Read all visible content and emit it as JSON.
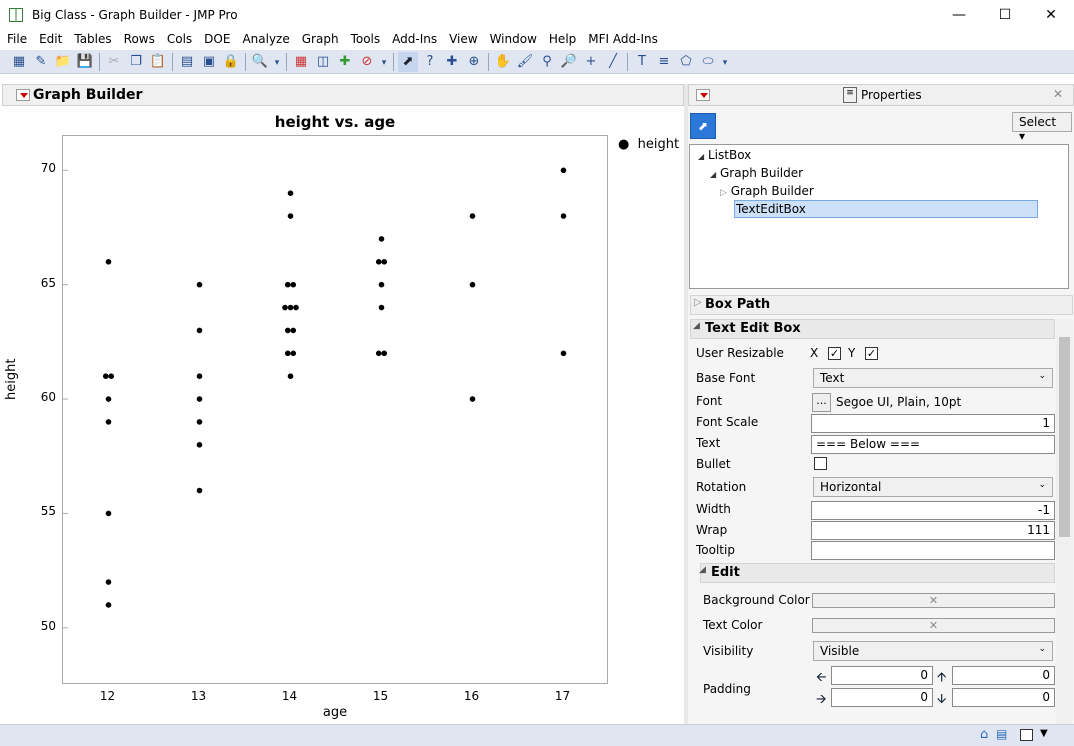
{
  "window": {
    "title": "Big Class - Graph Builder - JMP Pro"
  },
  "menu": [
    "File",
    "Edit",
    "Tables",
    "Rows",
    "Cols",
    "DOE",
    "Analyze",
    "Graph",
    "Tools",
    "Add-Ins",
    "View",
    "Window",
    "Help",
    "MFI Add-Ins"
  ],
  "graph_builder": {
    "header": "Graph Builder",
    "legend_label": "height"
  },
  "chart_data": {
    "type": "scatter",
    "title": "height vs. age",
    "xlabel": "age",
    "ylabel": "height",
    "x_ticks": [
      "12",
      "13",
      "14",
      "15",
      "16",
      "17"
    ],
    "y_ticks": [
      "50",
      "55",
      "60",
      "65",
      "70"
    ],
    "ylim": [
      47.5,
      71.5
    ],
    "xlim": [
      11.5,
      17.5
    ],
    "grid": false,
    "legend": "top-right",
    "points": [
      [
        12,
        66
      ],
      [
        12,
        61
      ],
      [
        12,
        61
      ],
      [
        12,
        60
      ],
      [
        12,
        59
      ],
      [
        12,
        55
      ],
      [
        12,
        52
      ],
      [
        12,
        51
      ],
      [
        13,
        65
      ],
      [
        13,
        63
      ],
      [
        13,
        61
      ],
      [
        13,
        60
      ],
      [
        13,
        59
      ],
      [
        13,
        58
      ],
      [
        13,
        56
      ],
      [
        14,
        69
      ],
      [
        14,
        68
      ],
      [
        14,
        65
      ],
      [
        14,
        65
      ],
      [
        14,
        64
      ],
      [
        14,
        64
      ],
      [
        14,
        64
      ],
      [
        14,
        63
      ],
      [
        14,
        63
      ],
      [
        14,
        62
      ],
      [
        14,
        62
      ],
      [
        14,
        61
      ],
      [
        15,
        67
      ],
      [
        15,
        66
      ],
      [
        15,
        66
      ],
      [
        15,
        65
      ],
      [
        15,
        64
      ],
      [
        15,
        62
      ],
      [
        15,
        62
      ],
      [
        16,
        68
      ],
      [
        16,
        65
      ],
      [
        16,
        60
      ],
      [
        17,
        70
      ],
      [
        17,
        68
      ],
      [
        17,
        62
      ]
    ]
  },
  "properties": {
    "title": "Properties",
    "select_label": "Select",
    "tree": [
      "ListBox",
      "Graph Builder",
      "Graph Builder",
      "TextEditBox"
    ],
    "box_path": "Box Path",
    "text_edit_box": "Text Edit Box",
    "user_resizable": "User Resizable",
    "x_label": "X",
    "y_label": "Y",
    "base_font": "Base Font",
    "base_font_value": "Text",
    "font": "Font",
    "font_button": "...",
    "font_value": "Segoe UI, Plain, 10pt",
    "font_scale": "Font Scale",
    "font_scale_value": "1",
    "text": "Text",
    "text_value": "=== Below ===",
    "bullet": "Bullet",
    "rotation": "Rotation",
    "rotation_value": "Horizontal",
    "width": "Width",
    "width_value": "-1",
    "wrap": "Wrap",
    "wrap_value": "111",
    "tooltip": "Tooltip",
    "tooltip_value": "",
    "edit": "Edit",
    "background_color": "Background Color",
    "text_color": "Text Color",
    "visibility": "Visibility",
    "visibility_value": "Visible",
    "padding": "Padding",
    "padding_values": [
      "0",
      "0",
      "0",
      "0"
    ]
  }
}
